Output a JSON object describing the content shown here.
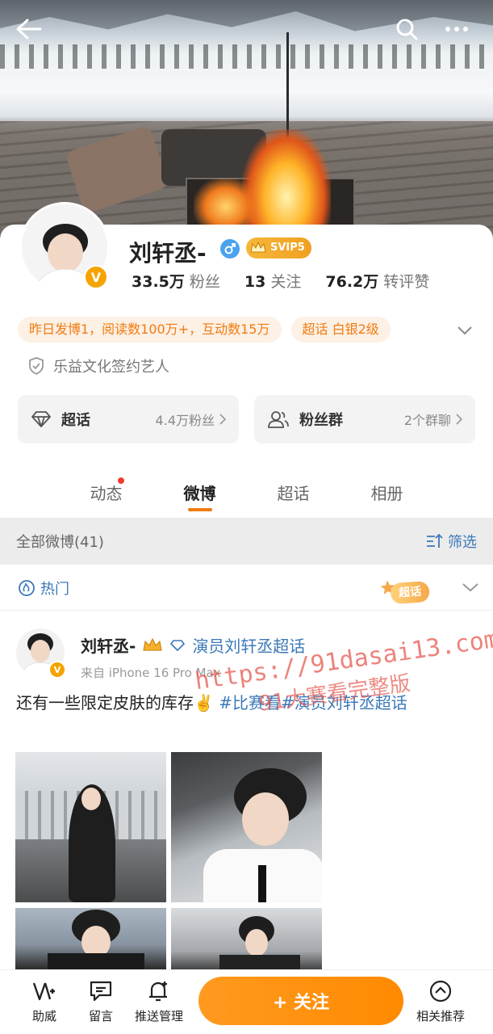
{
  "profile": {
    "name": "刘轩丞-",
    "svip": "SVIP5",
    "stats": [
      {
        "num": "33.5万",
        "label": "粉丝"
      },
      {
        "num": "13",
        "label": "关注"
      },
      {
        "num": "76.2万",
        "label": "转评赞"
      }
    ],
    "highlights": [
      "昨日发博1，阅读数100万+，互动数15万",
      "超话 白银2级"
    ],
    "sign": "乐益文化签约艺人",
    "tiles": [
      {
        "label": "超话",
        "value": "4.4万粉丝"
      },
      {
        "label": "粉丝群",
        "value": "2个群聊"
      }
    ]
  },
  "tabs": [
    {
      "label": "动态"
    },
    {
      "label": "微博"
    },
    {
      "label": "超话"
    },
    {
      "label": "相册"
    }
  ],
  "filter": {
    "all_label": "全部微博(41)",
    "filter_label": "筛选"
  },
  "hot": {
    "label": "热门",
    "tag": "超话"
  },
  "post": {
    "author": "刘轩丞-",
    "topic_link": "演员刘轩丞超话",
    "source": "来自 iPhone 16 Pro Max",
    "text_plain": "还有一些限定皮肤的库存✌️",
    "text_topic": "#比赛看#演员刘轩丞超话",
    "watermark_line1": "https://91dasai13.com",
    "watermark_line2": "91大赛看完整版"
  },
  "bottom": {
    "items": [
      "助威",
      "留言",
      "推送管理",
      "相关推荐"
    ],
    "follow": "+ 关注"
  },
  "colors": {
    "accent": "#ff8a00",
    "link": "#3b78b8",
    "badge": "#f5a300"
  }
}
